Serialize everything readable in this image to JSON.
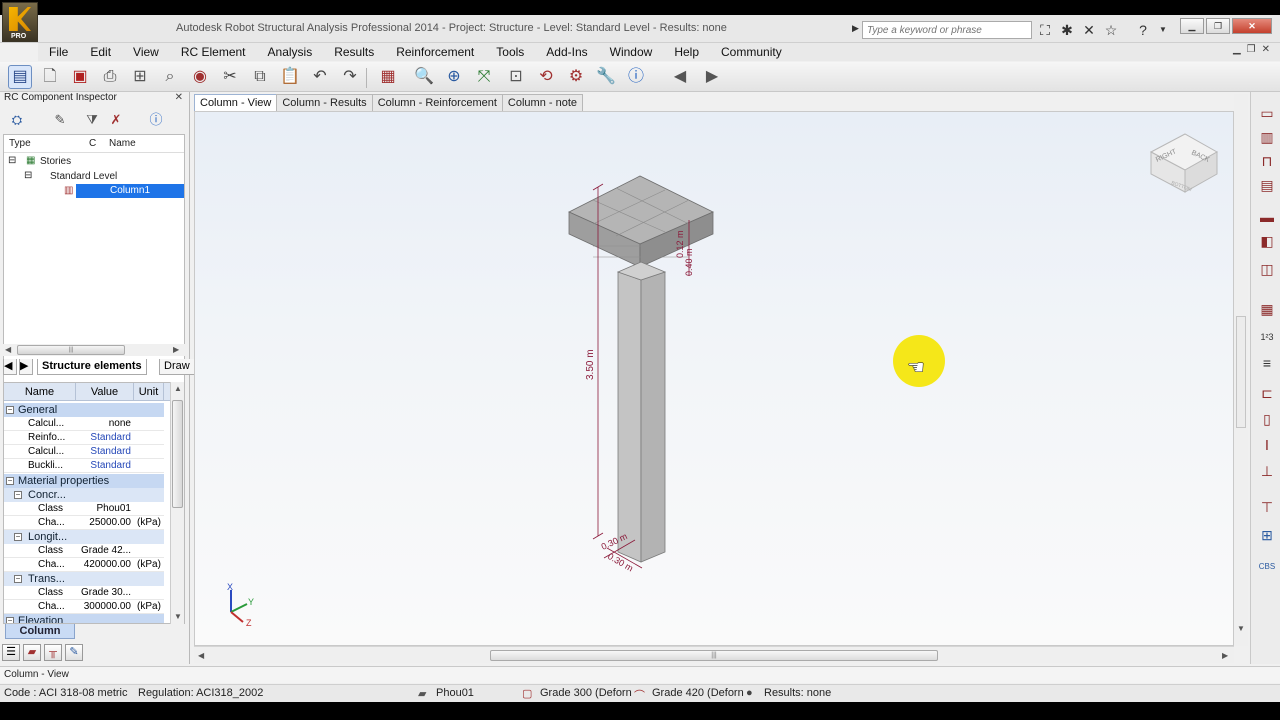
{
  "window": {
    "title": "Autodesk Robot Structural Analysis Professional 2014 - Project: Structure - Level: Standard Level - Results: none",
    "search_placeholder": "Type a keyword or phrase",
    "logo_text": "PRO"
  },
  "menu": [
    "File",
    "Edit",
    "View",
    "RC Element",
    "Analysis",
    "Results",
    "Reinforcement",
    "Tools",
    "Add-Ins",
    "Window",
    "Help",
    "Community"
  ],
  "inspector": {
    "title": "RC Component Inspector",
    "tree_columns": [
      "Type",
      "C",
      "Name"
    ],
    "tree": {
      "root": "Stories",
      "level": "Standard Level",
      "selected": "Column1"
    },
    "tabs": [
      "Structure elements",
      "Draw"
    ],
    "props_columns": [
      "Name",
      "Value",
      "Unit"
    ],
    "groups": {
      "general": "General",
      "material": "Material properties",
      "elevation": "Elevation",
      "concrete": "Concr...",
      "longit": "Longit...",
      "trans": "Trans..."
    },
    "rows": {
      "calc1": {
        "name": "Calcul...",
        "value": "none",
        "unit": ""
      },
      "reinf": {
        "name": "Reinfo...",
        "value": "Standard",
        "unit": ""
      },
      "calc2": {
        "name": "Calcul...",
        "value": "Standard",
        "unit": ""
      },
      "buckl": {
        "name": "Buckli...",
        "value": "Standard",
        "unit": ""
      },
      "conc_class": {
        "name": "Class",
        "value": "Phou01",
        "unit": ""
      },
      "conc_char": {
        "name": "Cha...",
        "value": "25000.00",
        "unit": "(kPa)"
      },
      "long_class": {
        "name": "Class",
        "value": "Grade 42...",
        "unit": ""
      },
      "long_char": {
        "name": "Cha...",
        "value": "420000.00",
        "unit": "(kPa)"
      },
      "trans_class": {
        "name": "Class",
        "value": "Grade 30...",
        "unit": ""
      },
      "trans_char": {
        "name": "Cha...",
        "value": "300000.00",
        "unit": "(kPa)"
      }
    },
    "bottom_tab": "Column"
  },
  "view_tabs": [
    "Column - View",
    "Column - Results",
    "Column - Reinforcement",
    "Column - note"
  ],
  "model": {
    "dim_height": "3.50 m",
    "dim_top": "0.12 m",
    "dim_top2": "0.40 m",
    "dim_base1": "0.30 m",
    "dim_base2": "0.30 m",
    "axis_x": "X",
    "axis_y": "Y",
    "axis_z": "Z",
    "cube_right": "RIGHT",
    "cube_back": "BACK",
    "cube_bottom": "BOTTOM"
  },
  "view_name": "Column - View",
  "status": {
    "code": "Code : ACI 318-08 metric",
    "regulation": "Regulation: ACI318_2002",
    "concrete": "Phou01",
    "grade300": "Grade 300 (Deforn",
    "grade420": "Grade 420 (Deforn",
    "results": "Results: none"
  },
  "colors": {
    "accent": "#1e74e8",
    "dimension": "#8b1a3a",
    "cursor_highlight": "#f5e600"
  }
}
